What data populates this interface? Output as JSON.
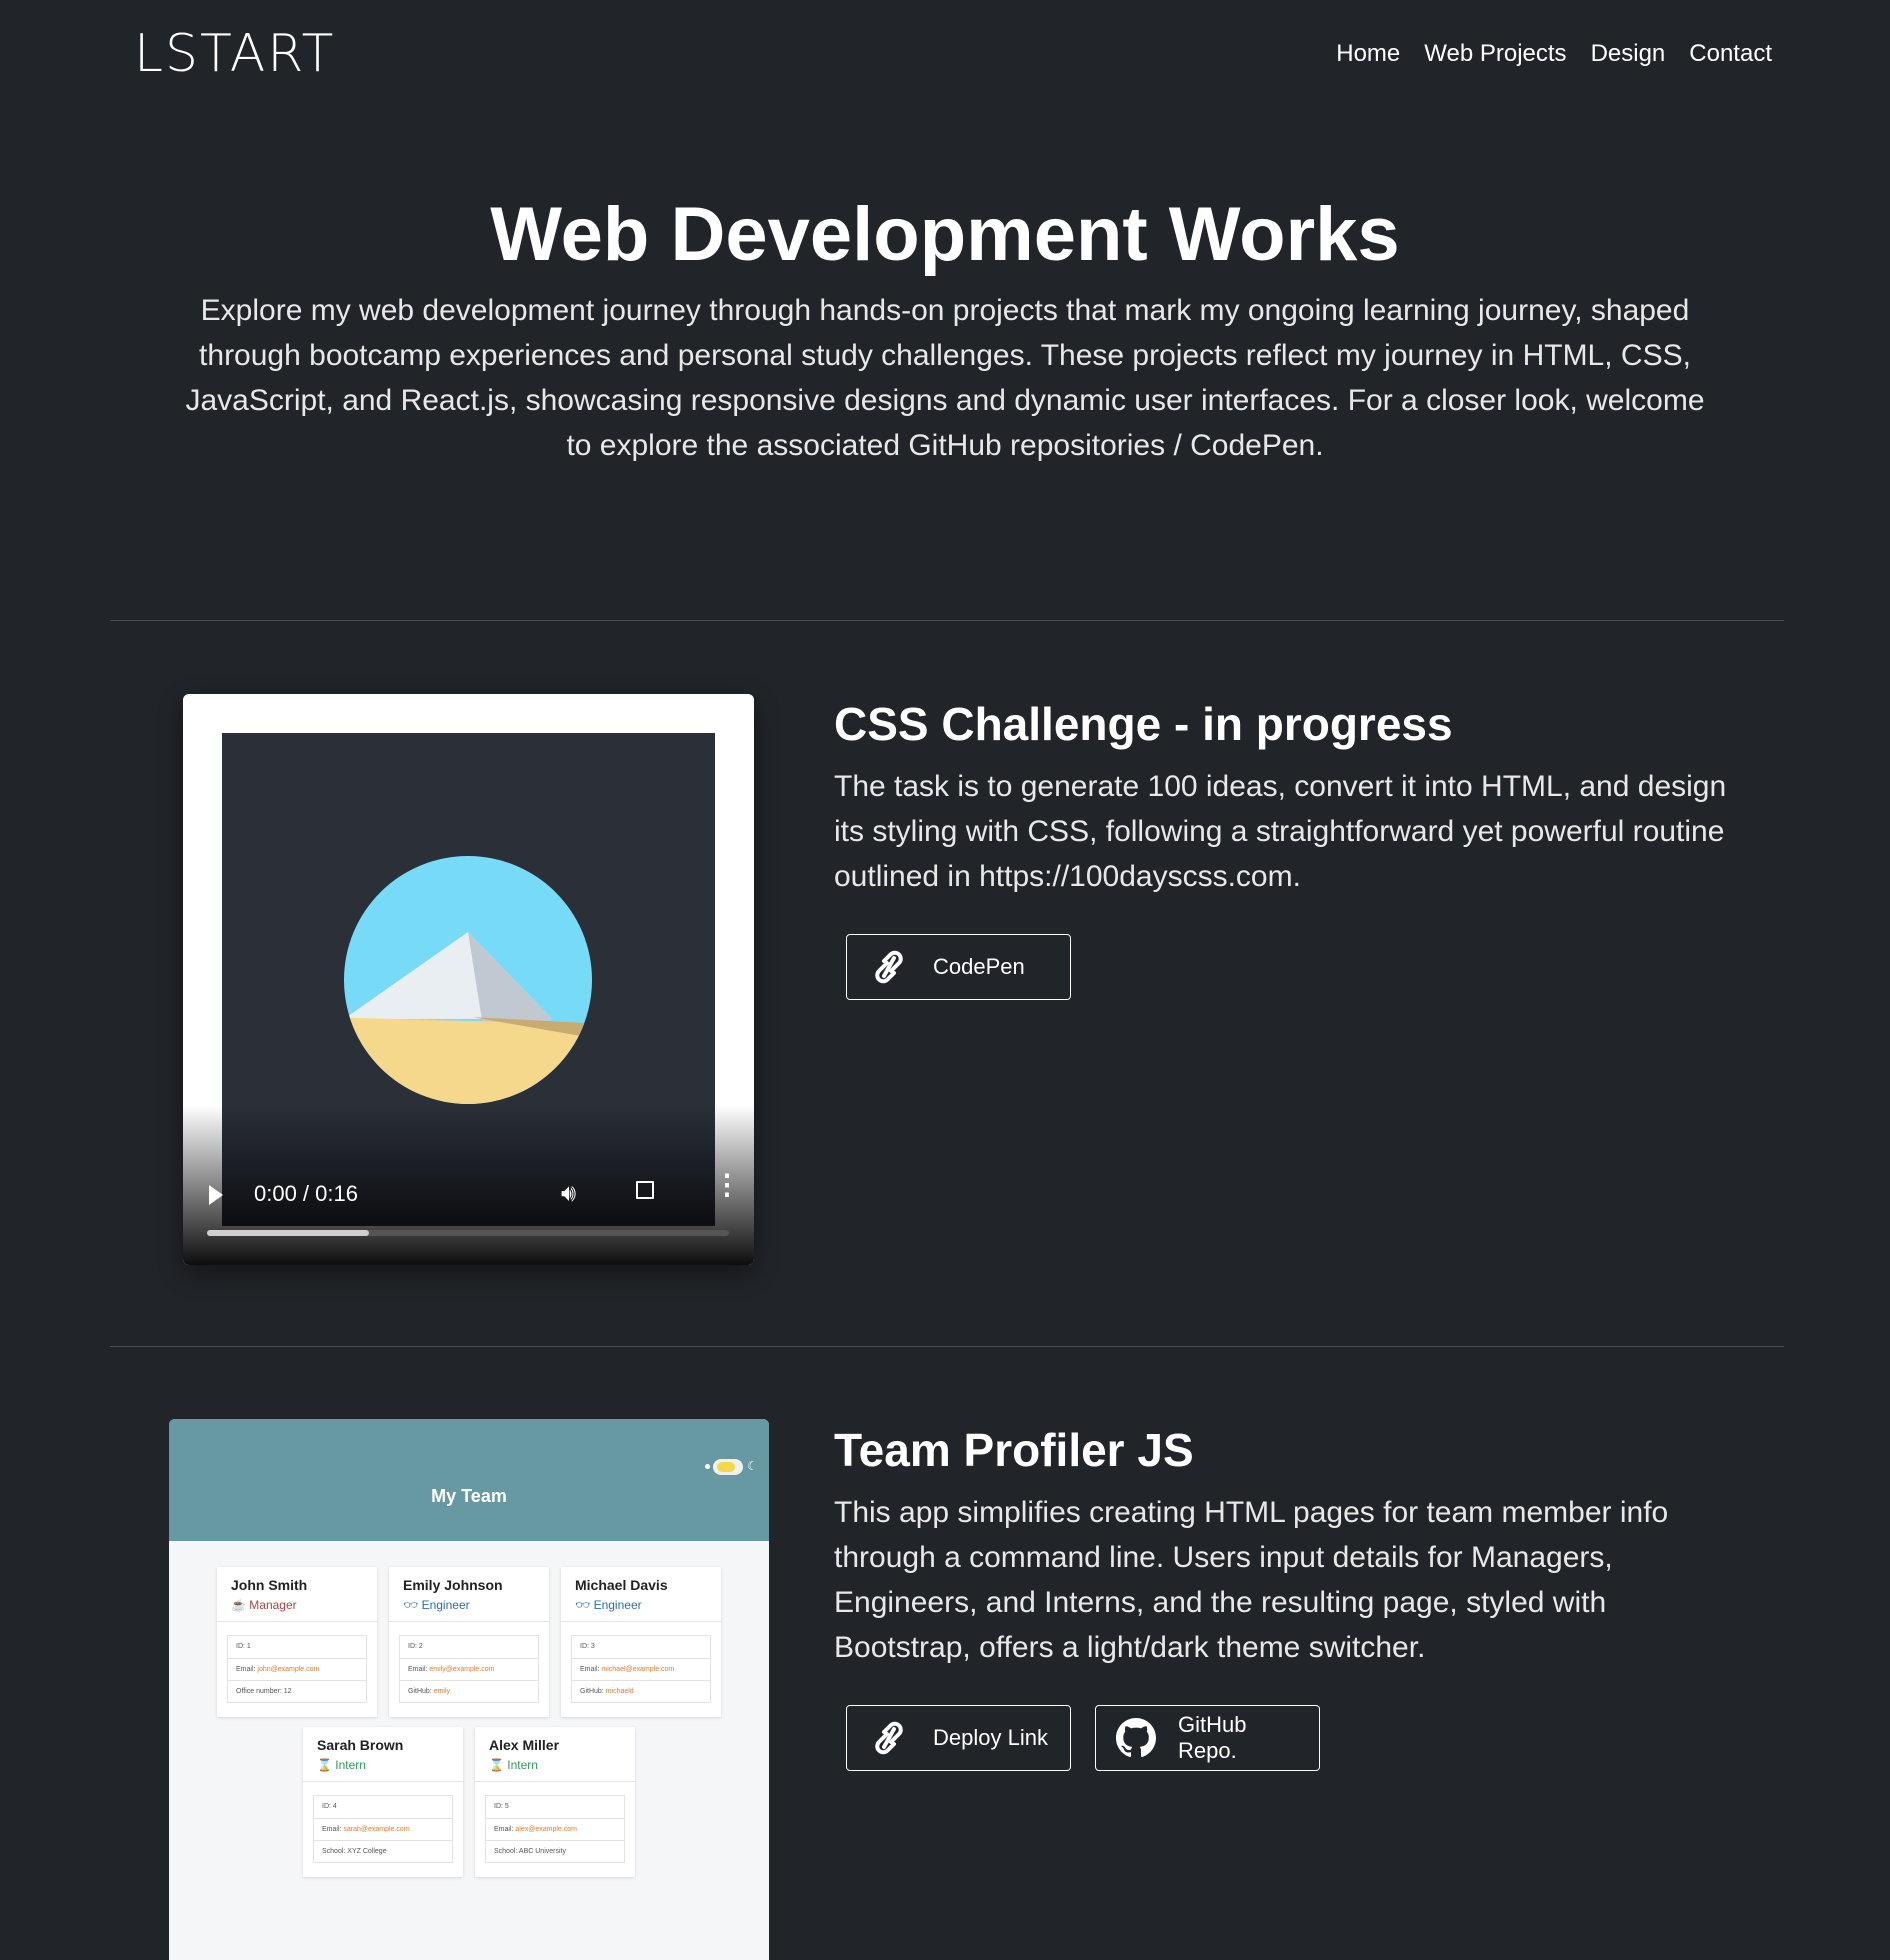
{
  "nav": {
    "logo": "LSTART",
    "links": [
      "Home",
      "Web Projects",
      "Design",
      "Contact"
    ]
  },
  "hero": {
    "title": "Web Development Works",
    "description": "Explore my web development journey through hands-on projects that mark my ongoing learning journey, shaped through bootcamp experiences and personal study challenges. These projects reflect my journey in HTML, CSS, JavaScript, and React.js, showcasing responsive designs and dynamic user interfaces. For a closer look, welcome to explore the associated GitHub repositories / CodePen."
  },
  "projects": [
    {
      "title": "CSS Challenge - in progress",
      "description": "The task is to generate 100 ideas, convert it into HTML, and design its styling with CSS, following a straightforward yet powerful routine outlined in https://100dayscss.com.",
      "video": {
        "time": "0:00 / 0:16",
        "progress": 0.31
      },
      "buttons": [
        {
          "label": "CodePen",
          "icon": "link-icon"
        }
      ]
    },
    {
      "title": "Team Profiler JS",
      "description": "This app simplifies creating HTML pages for team member info through a command line. Users input details for Managers, Engineers, and Interns, and the resulting page, styled with Bootstrap, offers a light/dark theme switcher.",
      "buttons": [
        {
          "label": "Deploy Link",
          "icon": "link-icon"
        },
        {
          "label": "GitHub Repo.",
          "icon": "github-icon"
        }
      ],
      "preview": {
        "header": "My Team",
        "cards": [
          {
            "name": "John Smith",
            "role": "Manager",
            "role_color": "#a94442",
            "id": "ID: 1",
            "email_label": "Email: ",
            "email": "john@example.com",
            "extra": "Office number: 12"
          },
          {
            "name": "Emily Johnson",
            "role": "Engineer",
            "role_color": "#2b6ea8",
            "id": "ID: 2",
            "email_label": "Email: ",
            "email": "emily@example.com",
            "extra_label": "GitHub: ",
            "extra_link": "emily"
          },
          {
            "name": "Michael Davis",
            "role": "Engineer",
            "role_color": "#2b6ea8",
            "id": "ID: 3",
            "email_label": "Email: ",
            "email": "michael@example.com",
            "extra_label": "GitHub: ",
            "extra_link": "michaeld"
          },
          {
            "name": "Sarah Brown",
            "role": "Intern",
            "role_color": "#2e9a5a",
            "id": "ID: 4",
            "email_label": "Email: ",
            "email": "sarah@example.com",
            "extra": "School: XYZ College"
          },
          {
            "name": "Alex Miller",
            "role": "Intern",
            "role_color": "#2e9a5a",
            "id": "ID: 5",
            "email_label": "Email: ",
            "email": "alex@example.com",
            "extra": "School: ABC University"
          }
        ]
      }
    }
  ]
}
